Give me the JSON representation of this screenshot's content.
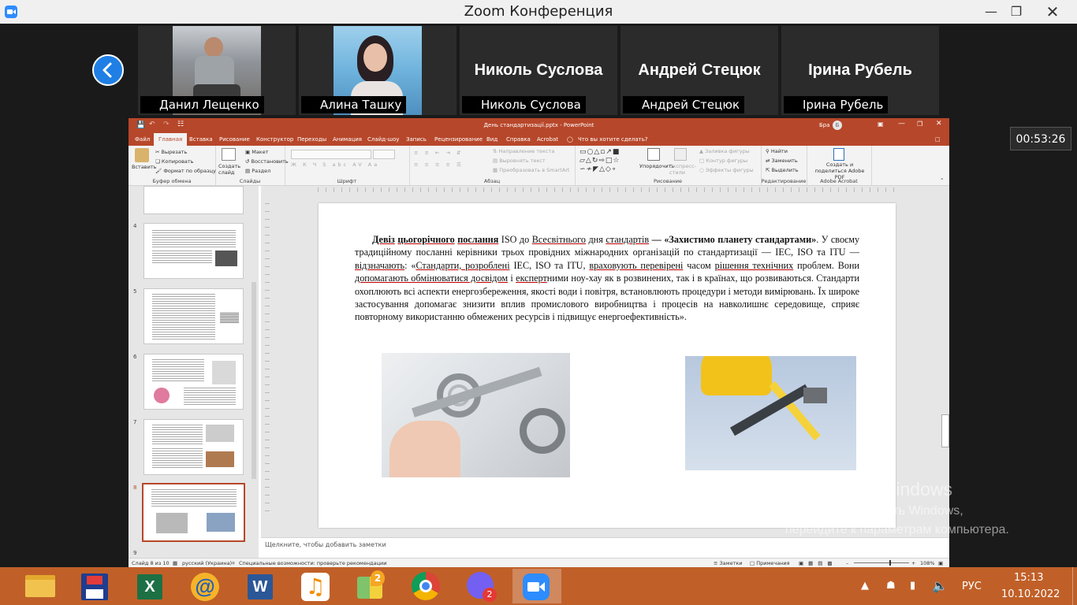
{
  "zoom": {
    "title": "Zoom Конференция",
    "timer": "00:53:26",
    "participants": [
      {
        "caption": "Данил Лещенко",
        "name_on_tile": ""
      },
      {
        "caption": "Алина Ташку",
        "name_on_tile": ""
      },
      {
        "caption": "Николь Суслова",
        "name_on_tile": "Николь Суслова"
      },
      {
        "caption": "Андрей Стецюк",
        "name_on_tile": "Андрей Стецюк"
      },
      {
        "caption": "Ірина Рубель",
        "name_on_tile": "Ірина Рубель"
      }
    ]
  },
  "ppt": {
    "doc_title": "День стандартизації.pptx - PowerPoint",
    "user": "Бра",
    "user_initial": "Б",
    "tabs": [
      "Файл",
      "Главная",
      "Вставка",
      "Рисование",
      "Конструктор",
      "Переходы",
      "Анимация",
      "Слайд-шоу",
      "Запись",
      "Рецензирование",
      "Вид",
      "Справка",
      "Acrobat"
    ],
    "search": "Что вы хотите сделать?",
    "groups": {
      "clipboard": {
        "label": "Буфер обмена",
        "paste": "Вставить",
        "cut": "Вырезать",
        "copy": "Копировать",
        "format": "Формат по образцу"
      },
      "slides": {
        "label": "Слайды",
        "new": "Создать слайд",
        "layout": "Макет",
        "reset": "Восстановить",
        "section": "Раздел"
      },
      "font": {
        "label": "Шрифт"
      },
      "paragraph": {
        "label": "Абзац",
        "direction": "Направление текста",
        "align": "Выровнять текст",
        "smartart": "Преобразовать в SmartArt"
      },
      "drawing": {
        "label": "Рисование",
        "arrange": "Упорядочить",
        "styles": "Экспресс-стили",
        "fill": "Заливка фигуры",
        "outline": "Контур фигуры",
        "effects": "Эффекты фигуры"
      },
      "editing": {
        "label": "Редактирование",
        "find": "Найти",
        "replace": "Заменить",
        "select": "Выделить"
      },
      "acrobat": {
        "label": "Adobe Acrobat",
        "create": "Создать и поделиться Adobe PDF"
      }
    },
    "thumbnails": [
      "4",
      "5",
      "6",
      "7",
      "8",
      "9"
    ],
    "slide_text": {
      "p1": "Девіз",
      "p2": "цьогорічного",
      "p3": "послання",
      "p4": "ISO до",
      "p5": "Всесвітнього",
      "p6": "дня",
      "p7": "стандартів",
      "p8": "— «Захистимо планету стандартами»",
      "p9": ". У своєму традиційному посланні керівники трьох провідних міжнародних організацій по стандартизації — IEC, ISO та ITU —",
      "p10": "відзначають",
      "p11": ": «",
      "p12": "Стандарти, розроблені",
      "p13": "IEC, ISO та ITU,",
      "p14": "враховують перевірені",
      "p15": "часом",
      "p16": "рішення технічних",
      "p17": "проблем. Вони",
      "p18": "допомагають обмінюватися досвідом",
      "p19": "і",
      "p20": "експерт",
      "p21": "ними ноу-хау як в розвинених, так і в країнах, що розвиваються. Стандарти охоплюють всі аспекти енергозбереження, якості води і повітря, встановлюють процедури і методи вимірювань. Їх широке застосування допомагає знизити вплив промислового виробництва і процесів на навколишнє середовище, сприяє повторному використанню обмежених ресурсів і підвищує енергоефективність»."
    },
    "notes": "Щелкните, чтобы добавить заметки",
    "status": {
      "slide": "Слайд 8 из 10",
      "lang": "русский (Украина)",
      "access": "Специальные возможности: проверьте рекомендации",
      "notes": "Заметки",
      "comments": "Примечания",
      "zoom": "108%"
    }
  },
  "activation": {
    "title": "Активация Windows",
    "line1": "Чтобы активировать Windows,",
    "line2": "перейдите к параметрам компьютера."
  },
  "taskbar": {
    "lang": "РУС",
    "time": "15:13",
    "date": "10.10.2022",
    "viber_badge": "2",
    "maps_badge": "2"
  }
}
